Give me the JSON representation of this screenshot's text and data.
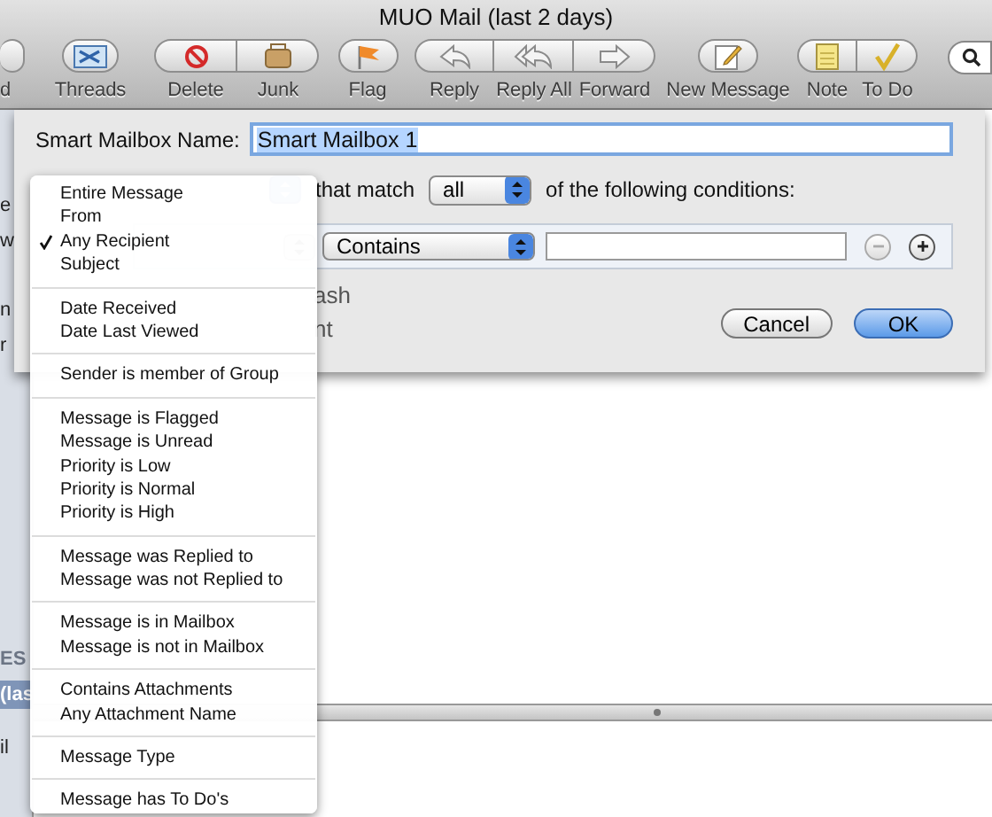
{
  "window": {
    "title": "MUO Mail (last 2 days)"
  },
  "toolbar": {
    "groups": [
      {
        "buttons": [
          {
            "kind": "cut",
            "label": "d"
          }
        ]
      },
      {
        "buttons": [
          {
            "kind": "threads",
            "label": "Threads"
          }
        ]
      },
      {
        "buttons": [
          {
            "kind": "delete",
            "label": "Delete"
          },
          {
            "kind": "junk",
            "label": "Junk"
          }
        ]
      },
      {
        "buttons": [
          {
            "kind": "flag",
            "label": "Flag"
          }
        ]
      },
      {
        "buttons": [
          {
            "kind": "reply",
            "label": "Reply"
          },
          {
            "kind": "reply_all",
            "label": "Reply All"
          },
          {
            "kind": "forward",
            "label": "Forward"
          }
        ]
      },
      {
        "buttons": [
          {
            "kind": "new_message",
            "label": "New Message"
          }
        ]
      },
      {
        "buttons": [
          {
            "kind": "note",
            "label": "Note"
          },
          {
            "kind": "todo",
            "label": "To Do"
          }
        ]
      }
    ]
  },
  "sidebar": {
    "items": [
      {
        "kind": "item",
        "label": "e",
        "selected": false
      },
      {
        "kind": "item",
        "label": "w",
        "selected": false
      },
      {
        "kind": "item",
        "label": "n",
        "selected": false
      },
      {
        "kind": "item",
        "label": "r",
        "selected": false
      },
      {
        "kind": "heading",
        "label": "ES",
        "selected": false
      },
      {
        "kind": "item",
        "label": "(las",
        "selected": true
      },
      {
        "kind": "item",
        "label": "il",
        "selected": false
      }
    ]
  },
  "dialog": {
    "name_label": "Smart Mailbox Name:",
    "name_value": "Smart Mailbox 1",
    "name_text_selected": true,
    "match_label": "that match",
    "match_value": "all",
    "conditions_label": "of the following conditions:",
    "condition": {
      "operator": "Contains",
      "remove_disabled": true
    },
    "option_fragments": [
      "ash",
      "nt"
    ],
    "buttons": [
      {
        "label": "Cancel",
        "default": false
      },
      {
        "label": "OK",
        "default": true
      }
    ]
  },
  "menu": {
    "sections": [
      {
        "items": [
          {
            "label": "Entire Message",
            "checked": false
          },
          {
            "label": "From",
            "checked": false
          },
          {
            "label": "Any Recipient",
            "checked": true
          },
          {
            "label": "Subject",
            "checked": false
          }
        ]
      },
      {
        "items": [
          {
            "label": "Date Received",
            "checked": false
          },
          {
            "label": "Date Last Viewed",
            "checked": false
          }
        ]
      },
      {
        "items": [
          {
            "label": "Sender is member of Group",
            "checked": false
          }
        ]
      },
      {
        "items": [
          {
            "label": "Message is Flagged",
            "checked": false
          },
          {
            "label": "Message is Unread",
            "checked": false
          },
          {
            "label": "Priority is Low",
            "checked": false
          },
          {
            "label": "Priority is Normal",
            "checked": false
          },
          {
            "label": "Priority is High",
            "checked": false
          }
        ]
      },
      {
        "items": [
          {
            "label": "Message was Replied to",
            "checked": false
          },
          {
            "label": "Message was not Replied to",
            "checked": false
          }
        ]
      },
      {
        "items": [
          {
            "label": "Message is in Mailbox",
            "checked": false
          },
          {
            "label": "Message is not in Mailbox",
            "checked": false
          }
        ]
      },
      {
        "items": [
          {
            "label": "Contains Attachments",
            "checked": false
          },
          {
            "label": "Any Attachment Name",
            "checked": false
          }
        ]
      },
      {
        "items": [
          {
            "label": "Message Type",
            "checked": false
          }
        ]
      },
      {
        "items": [
          {
            "label": "Message has To Do's",
            "checked": false
          }
        ]
      }
    ]
  }
}
